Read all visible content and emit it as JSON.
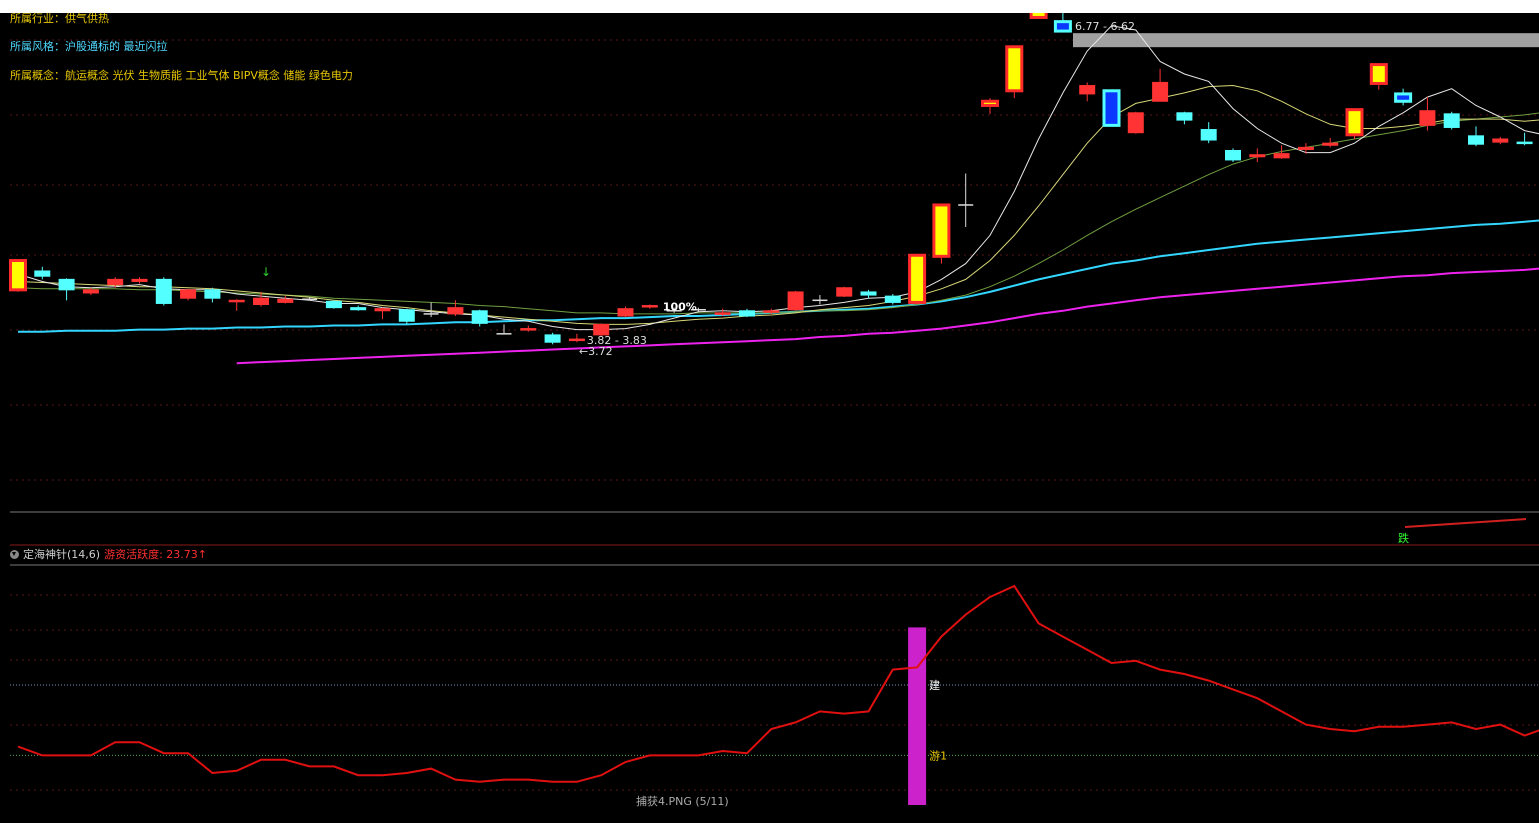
{
  "info": {
    "industry": "所属行业：供气供热",
    "style": "所属风格：沪股通标的 最近闪拉",
    "concept": "所属概念：航运概念 光伏 生物质能 工业气体 BIPV概念 储能 绿色电力"
  },
  "colors": {
    "up": "#ff3333",
    "down": "#54ffff",
    "limit_up": "#ffff00",
    "limit_frame": "#ff2a2a",
    "big_down": "#0a38ff",
    "ma5": "#e8e8e8",
    "ma10": "#d8d878",
    "ma20": "#70a040",
    "ma60": "#33d6ff",
    "ma120": "#ee22ee",
    "indicator_line": "#e01010",
    "highlight_bar": "#cc22cc",
    "annotation_band": "#a0a0a0"
  },
  "annotations": {
    "high_label": "6.77 - 6.62",
    "low_label": "3.82 - 3.83",
    "low_arrow_label": "←3.72",
    "pct_label": "100%",
    "fall_label": "跌",
    "arrow_mark": "↓"
  },
  "indicator": {
    "name": "定海神针(14,6)",
    "metric_label": "游资活跃度: 23.73",
    "metric_arrow": "↑",
    "mark_build": "建",
    "mark_you": "游1"
  },
  "caption": "捕获4.PNG (5/11)",
  "chart_data": {
    "type": "candlestick",
    "price_range": [
      3.5,
      7.0
    ],
    "candles": [
      {
        "o": 4.58,
        "c": 4.3,
        "h": 4.58,
        "l": 4.28,
        "s": "limit"
      },
      {
        "o": 4.48,
        "c": 4.43,
        "h": 4.52,
        "l": 4.4,
        "s": "down"
      },
      {
        "o": 4.4,
        "c": 4.3,
        "h": 4.41,
        "l": 4.2,
        "s": "down"
      },
      {
        "o": 4.3,
        "c": 4.27,
        "h": 4.32,
        "l": 4.25,
        "s": "up"
      },
      {
        "o": 4.35,
        "c": 4.4,
        "h": 4.42,
        "l": 4.32,
        "s": "up"
      },
      {
        "o": 4.38,
        "c": 4.4,
        "h": 4.42,
        "l": 4.36,
        "s": "up"
      },
      {
        "o": 4.4,
        "c": 4.17,
        "h": 4.42,
        "l": 4.15,
        "s": "down"
      },
      {
        "o": 4.22,
        "c": 4.3,
        "h": 4.31,
        "l": 4.2,
        "s": "up"
      },
      {
        "o": 4.3,
        "c": 4.22,
        "h": 4.32,
        "l": 4.18,
        "s": "down"
      },
      {
        "o": 4.19,
        "c": 4.2,
        "h": 4.21,
        "l": 4.1,
        "s": "up"
      },
      {
        "o": 4.16,
        "c": 4.22,
        "h": 4.28,
        "l": 4.14,
        "s": "up"
      },
      {
        "o": 4.18,
        "c": 4.21,
        "h": 4.24,
        "l": 4.17,
        "s": "up"
      },
      {
        "o": 4.21,
        "c": 4.21,
        "h": 4.23,
        "l": 4.2,
        "s": "flat"
      },
      {
        "o": 4.19,
        "c": 4.13,
        "h": 4.2,
        "l": 4.12,
        "s": "down"
      },
      {
        "o": 4.13,
        "c": 4.11,
        "h": 4.15,
        "l": 4.1,
        "s": "down"
      },
      {
        "o": 4.1,
        "c": 4.12,
        "h": 4.13,
        "l": 4.02,
        "s": "up"
      },
      {
        "o": 4.11,
        "c": 4.0,
        "h": 4.12,
        "l": 3.97,
        "s": "down"
      },
      {
        "o": 4.07,
        "c": 4.06,
        "h": 4.18,
        "l": 4.04,
        "s": "flat"
      },
      {
        "o": 4.07,
        "c": 4.13,
        "h": 4.2,
        "l": 4.05,
        "s": "up"
      },
      {
        "o": 4.1,
        "c": 3.98,
        "h": 4.11,
        "l": 3.95,
        "s": "down"
      },
      {
        "o": 3.88,
        "c": 3.88,
        "h": 3.97,
        "l": 3.88,
        "s": "flat"
      },
      {
        "o": 3.93,
        "c": 3.92,
        "h": 3.96,
        "l": 3.9,
        "s": "up"
      },
      {
        "o": 3.87,
        "c": 3.8,
        "h": 3.89,
        "l": 3.78,
        "s": "down"
      },
      {
        "o": 3.82,
        "c": 3.83,
        "h": 3.88,
        "l": 3.8,
        "s": "up"
      },
      {
        "o": 3.87,
        "c": 3.97,
        "h": 3.98,
        "l": 3.86,
        "s": "up"
      },
      {
        "o": 4.05,
        "c": 4.12,
        "h": 4.14,
        "l": 4.04,
        "s": "up"
      },
      {
        "o": 4.14,
        "c": 4.15,
        "h": 4.16,
        "l": 4.12,
        "s": "up"
      },
      {
        "o": 4.1,
        "c": 4.1,
        "h": 4.13,
        "l": 4.08,
        "s": "flat"
      },
      {
        "o": 4.1,
        "c": 4.11,
        "h": 4.13,
        "l": 4.09,
        "s": "flat"
      },
      {
        "o": 4.07,
        "c": 4.08,
        "h": 4.12,
        "l": 4.05,
        "s": "up"
      },
      {
        "o": 4.1,
        "c": 4.05,
        "h": 4.12,
        "l": 4.04,
        "s": "down"
      },
      {
        "o": 4.09,
        "c": 4.1,
        "h": 4.12,
        "l": 4.07,
        "s": "up"
      },
      {
        "o": 4.11,
        "c": 4.28,
        "h": 4.29,
        "l": 4.1,
        "s": "up"
      },
      {
        "o": 4.19,
        "c": 4.2,
        "h": 4.25,
        "l": 4.16,
        "s": "flat"
      },
      {
        "o": 4.24,
        "c": 4.32,
        "h": 4.33,
        "l": 4.23,
        "s": "up"
      },
      {
        "o": 4.28,
        "c": 4.25,
        "h": 4.3,
        "l": 4.22,
        "s": "down"
      },
      {
        "o": 4.24,
        "c": 4.18,
        "h": 4.26,
        "l": 4.16,
        "s": "down"
      },
      {
        "o": 4.18,
        "c": 4.63,
        "h": 4.64,
        "l": 4.17,
        "s": "limit"
      },
      {
        "o": 4.62,
        "c": 5.11,
        "h": 5.11,
        "l": 4.55,
        "s": "limit"
      },
      {
        "o": 5.11,
        "c": 5.11,
        "h": 5.41,
        "l": 4.9,
        "s": "flat"
      },
      {
        "o": 6.06,
        "c": 6.1,
        "h": 6.13,
        "l": 5.98,
        "s": "limit"
      },
      {
        "o": 6.2,
        "c": 6.62,
        "h": 6.63,
        "l": 6.13,
        "s": "limit"
      },
      {
        "o": 6.9,
        "c": 6.98,
        "h": 6.98,
        "l": 6.9,
        "s": "limit"
      },
      {
        "o": 6.77,
        "c": 6.86,
        "h": 6.98,
        "l": 6.77,
        "s": "bigdown"
      },
      {
        "o": 6.17,
        "c": 6.25,
        "h": 6.28,
        "l": 6.1,
        "s": "up"
      },
      {
        "o": 6.2,
        "c": 5.87,
        "h": 6.21,
        "l": 5.86,
        "s": "bigdown"
      },
      {
        "o": 5.8,
        "c": 5.99,
        "h": 6.0,
        "l": 5.79,
        "s": "up"
      },
      {
        "o": 6.1,
        "c": 6.28,
        "h": 6.41,
        "l": 6.1,
        "s": "up"
      },
      {
        "o": 5.99,
        "c": 5.92,
        "h": 6.0,
        "l": 5.88,
        "s": "down"
      },
      {
        "o": 5.83,
        "c": 5.73,
        "h": 5.9,
        "l": 5.7,
        "s": "down"
      },
      {
        "o": 5.63,
        "c": 5.54,
        "h": 5.65,
        "l": 5.52,
        "s": "down"
      },
      {
        "o": 5.57,
        "c": 5.59,
        "h": 5.65,
        "l": 5.52,
        "s": "up"
      },
      {
        "o": 5.56,
        "c": 5.6,
        "h": 5.68,
        "l": 5.55,
        "s": "up"
      },
      {
        "o": 5.64,
        "c": 5.66,
        "h": 5.7,
        "l": 5.6,
        "s": "up"
      },
      {
        "o": 5.68,
        "c": 5.7,
        "h": 5.75,
        "l": 5.66,
        "s": "up"
      },
      {
        "o": 5.78,
        "c": 6.02,
        "h": 6.02,
        "l": 5.74,
        "s": "limit"
      },
      {
        "o": 6.27,
        "c": 6.45,
        "h": 6.45,
        "l": 6.21,
        "s": "limit"
      },
      {
        "o": 6.17,
        "c": 6.1,
        "h": 6.22,
        "l": 6.06,
        "s": "bigdown"
      },
      {
        "o": 6.01,
        "c": 5.87,
        "h": 6.14,
        "l": 5.82,
        "s": "up"
      },
      {
        "o": 5.98,
        "c": 5.85,
        "h": 6.0,
        "l": 5.83,
        "s": "down"
      },
      {
        "o": 5.77,
        "c": 5.69,
        "h": 5.86,
        "l": 5.67,
        "s": "down"
      },
      {
        "o": 5.71,
        "c": 5.74,
        "h": 5.76,
        "l": 5.69,
        "s": "up"
      },
      {
        "o": 5.71,
        "c": 5.7,
        "h": 5.8,
        "l": 5.68,
        "s": "down"
      }
    ],
    "ma5": [
      4.45,
      4.38,
      4.33,
      4.32,
      4.33,
      4.35,
      4.31,
      4.3,
      4.3,
      4.26,
      4.24,
      4.22,
      4.2,
      4.17,
      4.17,
      4.13,
      4.11,
      4.09,
      4.07,
      4.06,
      4.02,
      4.0,
      3.95,
      3.92,
      3.92,
      3.93,
      3.97,
      4.03,
      4.09,
      4.1,
      4.09,
      4.1,
      4.13,
      4.15,
      4.18,
      4.22,
      4.23,
      4.28,
      4.4,
      4.55,
      4.82,
      5.24,
      5.74,
      6.18,
      6.58,
      6.82,
      6.78,
      6.48,
      6.36,
      6.29,
      6.03,
      5.84,
      5.7,
      5.61,
      5.61,
      5.7,
      5.86,
      5.99,
      6.14,
      6.22,
      6.06,
      5.95,
      5.82,
      5.77
    ],
    "ma10": [
      4.38,
      4.37,
      4.36,
      4.35,
      4.34,
      4.33,
      4.33,
      4.32,
      4.31,
      4.29,
      4.27,
      4.25,
      4.23,
      4.2,
      4.18,
      4.15,
      4.13,
      4.1,
      4.08,
      4.06,
      4.04,
      4.02,
      4.0,
      3.98,
      3.97,
      3.97,
      3.98,
      4.0,
      4.02,
      4.03,
      4.05,
      4.06,
      4.08,
      4.11,
      4.13,
      4.15,
      4.19,
      4.24,
      4.31,
      4.4,
      4.58,
      4.82,
      5.1,
      5.4,
      5.7,
      5.95,
      6.08,
      6.13,
      6.18,
      6.24,
      6.25,
      6.2,
      6.1,
      5.98,
      5.88,
      5.84,
      5.84,
      5.86,
      5.89,
      5.93,
      5.93,
      5.93,
      5.91,
      5.93
    ],
    "ma20": [
      4.32,
      4.31,
      4.31,
      4.31,
      4.31,
      4.3,
      4.3,
      4.29,
      4.28,
      4.27,
      4.26,
      4.25,
      4.24,
      4.22,
      4.21,
      4.2,
      4.19,
      4.18,
      4.17,
      4.15,
      4.14,
      4.12,
      4.1,
      4.08,
      4.08,
      4.07,
      4.07,
      4.07,
      4.08,
      4.08,
      4.08,
      4.08,
      4.09,
      4.1,
      4.1,
      4.11,
      4.13,
      4.16,
      4.2,
      4.25,
      4.33,
      4.43,
      4.55,
      4.68,
      4.82,
      4.95,
      5.07,
      5.18,
      5.29,
      5.4,
      5.5,
      5.57,
      5.62,
      5.66,
      5.7,
      5.74,
      5.78,
      5.82,
      5.87,
      5.91,
      5.93,
      5.95,
      5.97,
      6.0
    ],
    "ma60": [
      3.9,
      3.9,
      3.91,
      3.91,
      3.91,
      3.92,
      3.92,
      3.93,
      3.93,
      3.94,
      3.94,
      3.95,
      3.95,
      3.96,
      3.96,
      3.97,
      3.97,
      3.98,
      3.99,
      3.99,
      4.0,
      4.01,
      4.01,
      4.02,
      4.03,
      4.03,
      4.04,
      4.05,
      4.05,
      4.06,
      4.07,
      4.08,
      4.09,
      4.1,
      4.11,
      4.12,
      4.14,
      4.16,
      4.19,
      4.23,
      4.28,
      4.34,
      4.4,
      4.45,
      4.5,
      4.55,
      4.58,
      4.62,
      4.65,
      4.68,
      4.71,
      4.74,
      4.76,
      4.78,
      4.8,
      4.82,
      4.84,
      4.86,
      4.88,
      4.9,
      4.92,
      4.93,
      4.95,
      4.97
    ],
    "ma120": [
      null,
      null,
      null,
      null,
      null,
      null,
      null,
      null,
      null,
      3.6,
      3.61,
      3.62,
      3.63,
      3.64,
      3.65,
      3.66,
      3.67,
      3.68,
      3.69,
      3.7,
      3.71,
      3.72,
      3.73,
      3.74,
      3.75,
      3.76,
      3.77,
      3.78,
      3.79,
      3.8,
      3.81,
      3.82,
      3.83,
      3.85,
      3.86,
      3.88,
      3.89,
      3.91,
      3.93,
      3.96,
      3.99,
      4.03,
      4.07,
      4.1,
      4.14,
      4.17,
      4.2,
      4.23,
      4.25,
      4.27,
      4.29,
      4.31,
      4.33,
      4.35,
      4.37,
      4.39,
      4.41,
      4.43,
      4.44,
      4.46,
      4.47,
      4.48,
      4.49,
      4.51
    ],
    "indicator_range": [
      0,
      100
    ],
    "indicator_values": [
      22,
      18,
      18,
      18,
      24,
      24,
      19,
      19,
      10,
      11,
      16,
      16,
      13,
      13,
      9,
      9,
      10,
      12,
      7,
      6,
      7,
      7,
      6,
      6,
      9,
      15,
      18,
      18,
      18,
      20,
      19,
      30,
      33,
      38,
      37,
      38,
      57,
      58,
      72,
      82,
      90,
      95,
      78,
      72,
      66,
      60,
      61,
      57,
      55,
      52,
      48,
      44,
      38,
      32,
      30,
      29,
      31,
      31,
      32,
      33,
      30,
      32,
      27,
      31
    ],
    "highlight_index": 37,
    "levels": {
      "build": 50,
      "you": 18
    }
  }
}
